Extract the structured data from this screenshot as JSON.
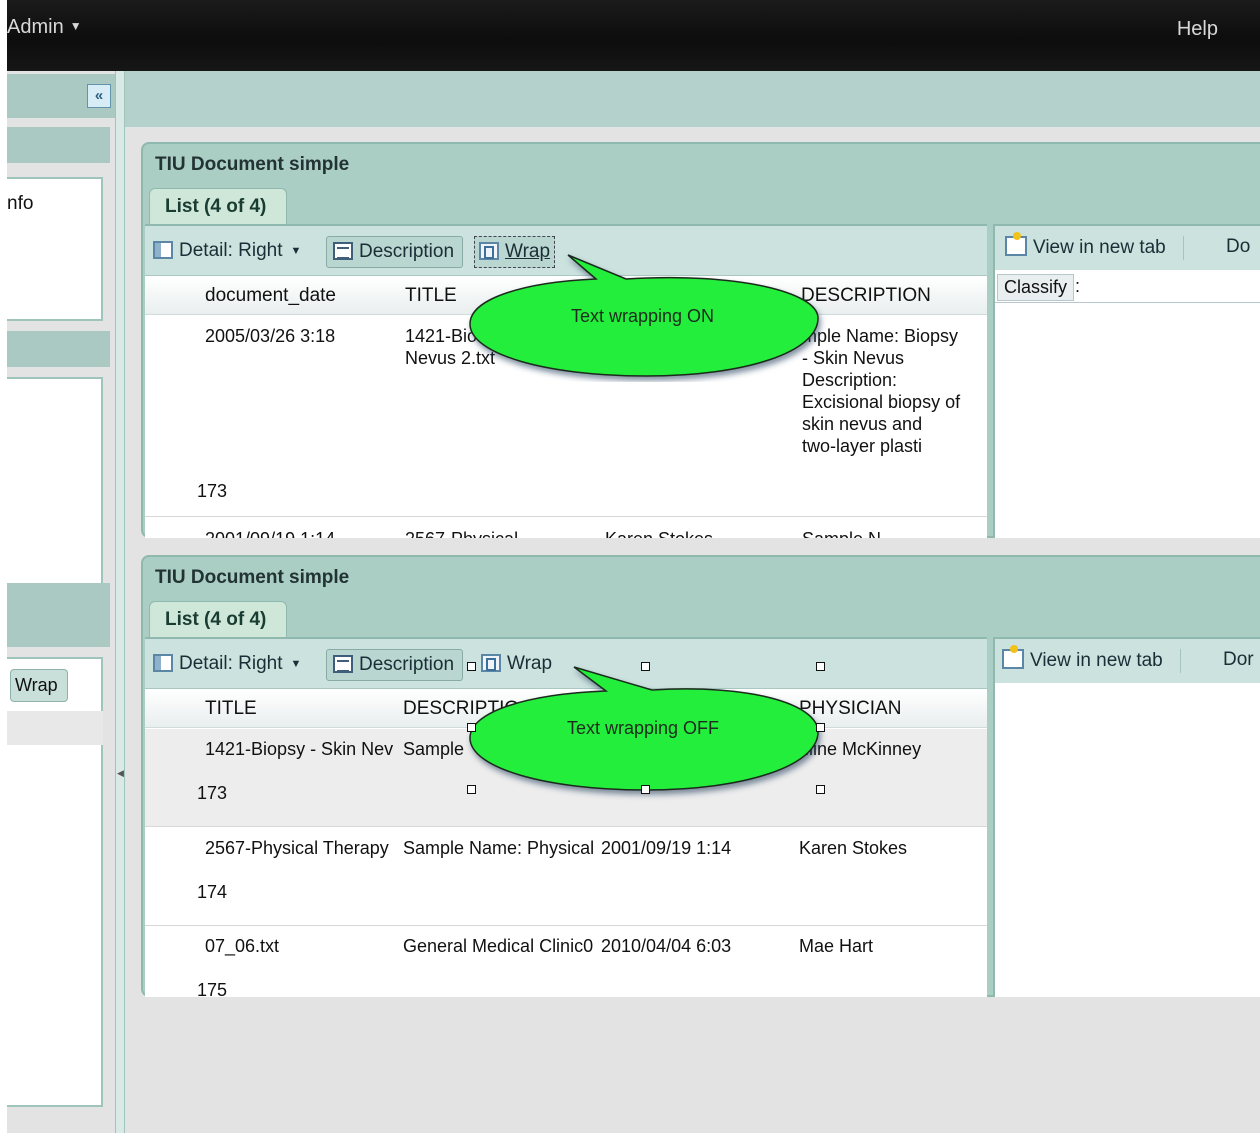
{
  "topbar": {
    "admin_label": "Admin",
    "admin_caret": "▼",
    "help_label": "Help"
  },
  "sidebar": {
    "collapse_symbol": "«",
    "info_label": "nfo",
    "wrap_label": "Wrap"
  },
  "panels": [
    {
      "title": "TIU Document simple",
      "tab_label": "List (4 of 4)",
      "toolbar": {
        "detail_label": "Detail: Right",
        "description_label": "Description",
        "wrap_label": "Wrap"
      },
      "columns": [
        "document_date",
        "TITLE",
        "DESCRIPTION"
      ],
      "rows": [
        {
          "document_date": "2005/03/26 3:18",
          "title_line1": "1421-Bio",
          "title_line2": "Nevus 2.txt",
          "desc_lines": [
            "mple Name: Biopsy",
            "- Skin Nevus",
            "Description:",
            "Excisional biopsy of",
            "skin nevus and",
            "two-layer plasti"
          ],
          "id": "173"
        },
        {
          "document_date": "2001/09/19 1:14",
          "title_line1": "2567-Physical",
          "physician": "Karen Stokes",
          "desc_lines": [
            "Sample N"
          ]
        }
      ],
      "detail": {
        "view_new_tab": "View in new tab",
        "done_label": "Do",
        "classify_label": "Classify",
        "classify_colon": ":"
      },
      "callout": "Text wrapping ON"
    },
    {
      "title": "TIU Document simple",
      "tab_label": "List (4 of 4)",
      "toolbar": {
        "detail_label": "Detail: Right",
        "description_label": "Description",
        "wrap_label": "Wrap"
      },
      "columns": [
        "TITLE",
        "DESCRIPTIO",
        "PHYSICIAN"
      ],
      "rows": [
        {
          "title": "1421-Biopsy - Skin Nev",
          "description": "Sample",
          "date": "",
          "physician": "uline McKinney",
          "id": "173"
        },
        {
          "title": "2567-Physical Therapy",
          "description": "Sample Name: Physical",
          "date": "2001/09/19 1:14",
          "physician": "Karen Stokes",
          "id": "174"
        },
        {
          "title": "07_06.txt",
          "description": "General Medical Clinic0",
          "date": "2010/04/04 6:03",
          "physician": "Mae Hart",
          "id": "175"
        }
      ],
      "detail": {
        "view_new_tab": "View in new tab",
        "done_label": "Dor"
      },
      "callout": "Text wrapping OFF"
    }
  ],
  "colors": {
    "callout_fill": "#22ee3a",
    "panel_teal": "#aacdc4",
    "topbar": "#111111"
  }
}
